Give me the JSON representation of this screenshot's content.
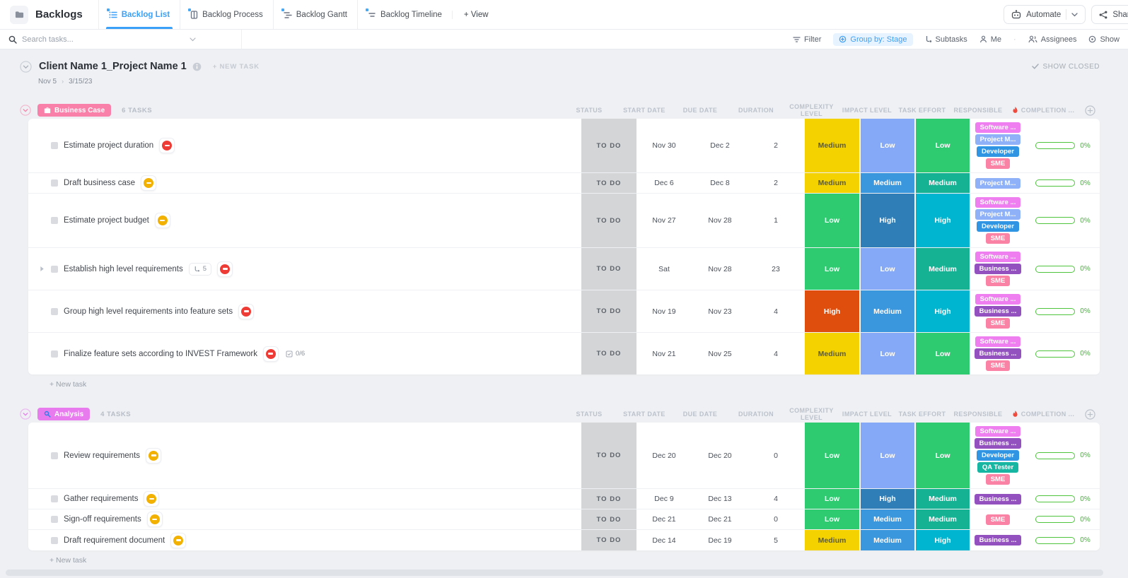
{
  "topbar": {
    "title": "Backlogs",
    "tabs": [
      {
        "label": "Backlog List",
        "active": true
      },
      {
        "label": "Backlog Process",
        "active": false
      },
      {
        "label": "Backlog Gantt",
        "active": false
      },
      {
        "label": "Backlog Timeline",
        "active": false
      }
    ],
    "add_view_label": "+ View",
    "automate_label": "Automate",
    "share_label": "Share"
  },
  "toolbar": {
    "search_placeholder": "Search tasks...",
    "filter_label": "Filter",
    "group_by_label": "Group by: Stage",
    "subtasks_label": "Subtasks",
    "me_label": "Me",
    "assignees_label": "Assignees",
    "show_label": "Show"
  },
  "project": {
    "name": "Client Name 1_Project Name 1",
    "new_task_label": "+ NEW TASK",
    "show_closed_label": "SHOW CLOSED",
    "date_start": "Nov 5",
    "date_end": "3/15/23"
  },
  "columns": [
    "STATUS",
    "START DATE",
    "DUE DATE",
    "DURATION",
    "COMPLEXITY LEVEL",
    "IMPACT LEVEL",
    "TASK EFFORT",
    "RESPONSIBLE",
    "COMPLETION ..."
  ],
  "new_task_row_label": "+ New task",
  "icons": {
    "search": "magnifier",
    "filter": "funnel",
    "automate": "robot",
    "share": "share-nodes",
    "business_case_group": "briefcase",
    "analysis_group": "magnifier",
    "completion_header": "red-flame",
    "priority": "round-flag",
    "collapse": "chevron-down-circle"
  },
  "colors": {
    "accent_blue": "#3ba0f7",
    "status_bg": "#d4d5d7",
    "progress_green": "#4ec43d",
    "priority": {
      "red": "#ee3b35",
      "yellow": "#f2b100"
    },
    "level": {
      "complexity": {
        "Low": "#2ecb71",
        "Medium": "#f3d200",
        "High": "#e04e0e"
      },
      "impact": {
        "Low": "#85a9f6",
        "Medium": "#3a96dd",
        "High": "#2f7eb7"
      },
      "effort": {
        "Low": "#2ecb71",
        "Medium": "#16b294",
        "High": "#00b5cf"
      }
    },
    "level_text_dark": "#5e5b33",
    "tags": {
      "Software ...": "#ef7ff1",
      "Project M...": "#8fb1f7",
      "Developer": "#3095e3",
      "SME": "#fa82a5",
      "Business ...": "#9351c0",
      "QA Tester": "#17b6a3"
    }
  },
  "groups": [
    {
      "name": "Business Case",
      "icon": "briefcase-icon",
      "color": "#f980a8",
      "count_label": "6 TASKS",
      "tasks": [
        {
          "name": "Estimate project duration",
          "priority": "red",
          "status": "TO DO",
          "start": "Nov 30",
          "due": "Dec 2",
          "duration": "2",
          "complexity": "Medium",
          "impact": "Low",
          "effort": "Low",
          "responsible": [
            "Software ...",
            "Project M...",
            "Developer",
            "SME"
          ],
          "completion": "0%"
        },
        {
          "name": "Draft business case",
          "priority": "yellow",
          "status": "TO DO",
          "start": "Dec 6",
          "due": "Dec 8",
          "duration": "2",
          "complexity": "Medium",
          "impact": "Medium",
          "effort": "Medium",
          "responsible": [
            "Project M..."
          ],
          "completion": "0%"
        },
        {
          "name": "Estimate project budget",
          "priority": "yellow",
          "status": "TO DO",
          "start": "Nov 27",
          "due": "Nov 28",
          "duration": "1",
          "complexity": "Low",
          "impact": "High",
          "effort": "High",
          "responsible": [
            "Software ...",
            "Project M...",
            "Developer",
            "SME"
          ],
          "completion": "0%"
        },
        {
          "name": "Establish high level requirements",
          "priority": "red",
          "expand": true,
          "subtasks": "5",
          "status": "TO DO",
          "start": "Sat",
          "due": "Nov 28",
          "duration": "23",
          "complexity": "Low",
          "impact": "Low",
          "effort": "Medium",
          "responsible": [
            "Software ...",
            "Business ...",
            "SME"
          ],
          "completion": "0%"
        },
        {
          "name": "Group high level requirements into feature sets",
          "priority": "red",
          "status": "TO DO",
          "start": "Nov 19",
          "due": "Nov 23",
          "duration": "4",
          "complexity": "High",
          "impact": "Medium",
          "effort": "High",
          "responsible": [
            "Software ...",
            "Business ...",
            "SME"
          ],
          "completion": "0%"
        },
        {
          "name": "Finalize feature sets according to INVEST Framework",
          "priority": "red",
          "checklist": "0/6",
          "status": "TO DO",
          "start": "Nov 21",
          "due": "Nov 25",
          "duration": "4",
          "complexity": "Medium",
          "impact": "Low",
          "effort": "Low",
          "responsible": [
            "Software ...",
            "Business ...",
            "SME"
          ],
          "completion": "0%"
        }
      ]
    },
    {
      "name": "Analysis",
      "icon": "magnifier-icon",
      "color": "#e87bee",
      "count_label": "4 TASKS",
      "tasks": [
        {
          "name": "Review requirements",
          "priority": "yellow",
          "status": "TO DO",
          "start": "Dec 20",
          "due": "Dec 20",
          "duration": "0",
          "complexity": "Low",
          "impact": "Low",
          "effort": "Low",
          "responsible": [
            "Software ...",
            "Business ...",
            "Developer",
            "QA Tester",
            "SME"
          ],
          "completion": "0%"
        },
        {
          "name": "Gather requirements",
          "priority": "yellow",
          "status": "TO DO",
          "start": "Dec 9",
          "due": "Dec 13",
          "duration": "4",
          "complexity": "Low",
          "impact": "High",
          "effort": "Medium",
          "responsible": [
            "Business ..."
          ],
          "completion": "0%"
        },
        {
          "name": "Sign-off requirements",
          "priority": "yellow",
          "status": "TO DO",
          "start": "Dec 21",
          "due": "Dec 21",
          "duration": "0",
          "complexity": "Low",
          "impact": "Medium",
          "effort": "Medium",
          "responsible": [
            "SME"
          ],
          "completion": "0%"
        },
        {
          "name": "Draft requirement document",
          "priority": "yellow",
          "status": "TO DO",
          "start": "Dec 14",
          "due": "Dec 19",
          "duration": "5",
          "complexity": "Medium",
          "impact": "Medium",
          "effort": "High",
          "responsible": [
            "Business ..."
          ],
          "completion": "0%"
        }
      ]
    }
  ]
}
